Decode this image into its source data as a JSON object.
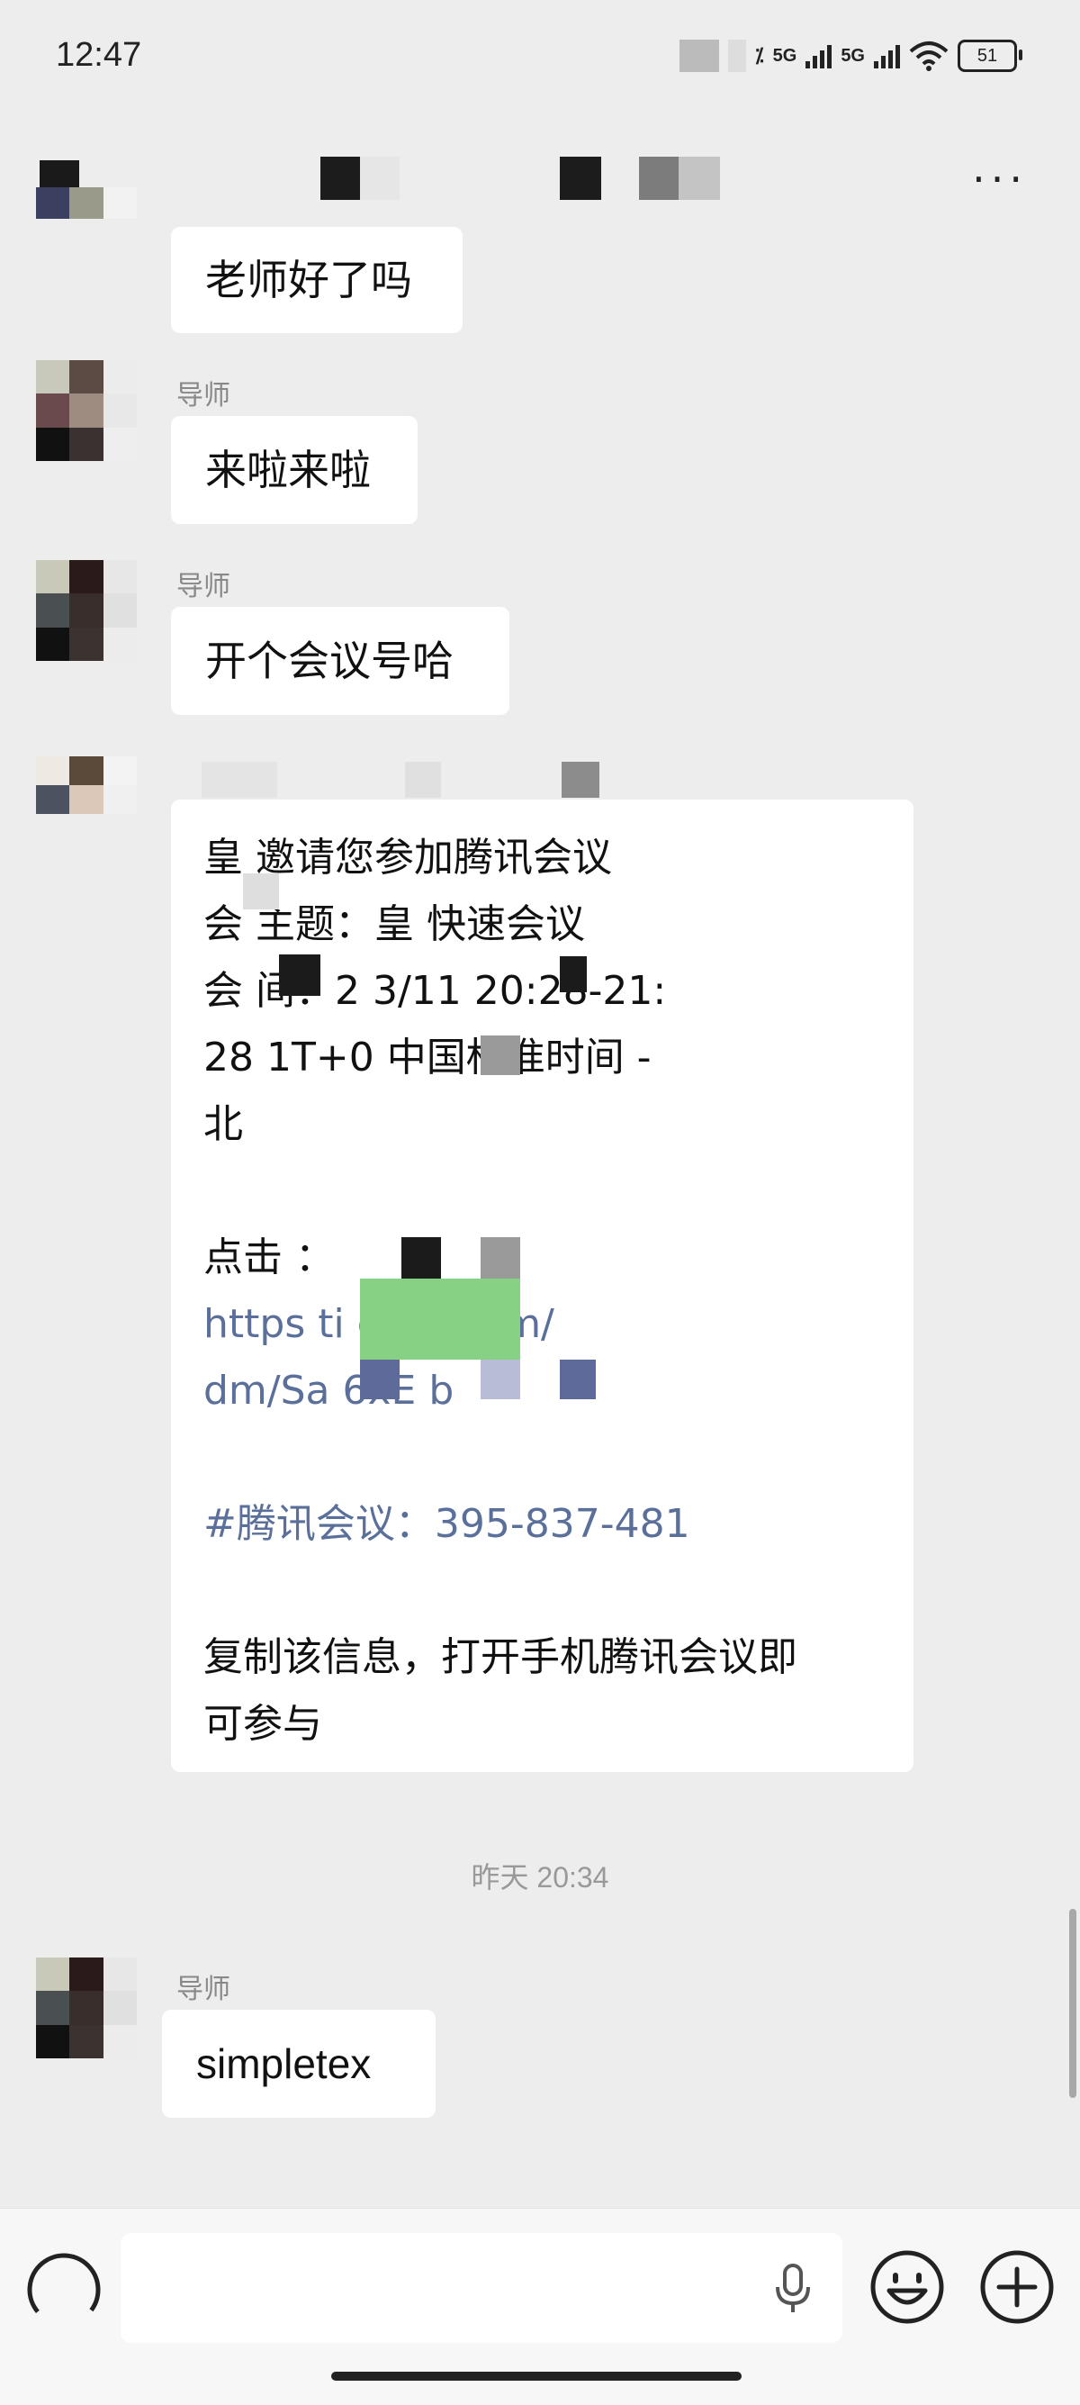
{
  "status_bar": {
    "time": "12:47",
    "net_1": "5G",
    "net_2": "5G",
    "battery": "51"
  },
  "header": {
    "more_label": "···"
  },
  "messages": [
    {
      "text": "老师好了吗"
    },
    {
      "sender": "导师",
      "text": "来啦来啦"
    },
    {
      "sender": "导师",
      "text": "开个会议号哈"
    }
  ],
  "meeting_card": {
    "line1": "皇  邀请您参加腾讯会议",
    "line2": "会  主题：皇   快速会议",
    "line3": "会   间：2      3/11 20:28-21:",
    "line4": "28    1T+0      中国标准时间 -",
    "line5": "北",
    "line6": "点击                    ：",
    "link1": "https        ti        cent.com/",
    "link2": "dm/Sa  6xE       b",
    "meeting_id": "#腾讯会议：395-837-481",
    "footer_1": "复制该信息，打开手机腾讯会议即",
    "footer_2": "可参与"
  },
  "timestamp": "昨天 20:34",
  "last_message": {
    "sender": "导师",
    "text": "simpletex"
  },
  "icons": {
    "voice": "voice-toggle-icon",
    "mic": "mic-icon",
    "emoji": "emoji-icon",
    "plus": "plus-icon"
  }
}
